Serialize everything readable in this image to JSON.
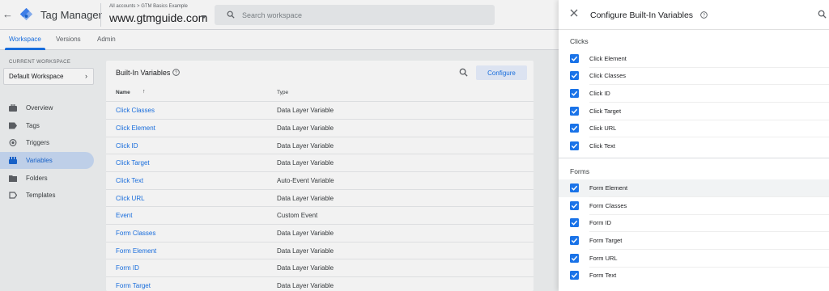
{
  "header": {
    "product_name": "Tag Manager",
    "account_path": "All accounts > GTM Basics Example",
    "container_name": "www.gtmguide.com",
    "search_placeholder": "Search workspace"
  },
  "tabs": [
    {
      "label": "Workspace"
    },
    {
      "label": "Versions"
    },
    {
      "label": "Admin"
    }
  ],
  "sidebar": {
    "current_workspace_label": "CURRENT WORKSPACE",
    "workspace_name": "Default Workspace",
    "items": [
      {
        "label": "Overview",
        "icon": "briefcase-icon"
      },
      {
        "label": "Tags",
        "icon": "tag-icon"
      },
      {
        "label": "Triggers",
        "icon": "trigger-icon"
      },
      {
        "label": "Variables",
        "icon": "variables-icon"
      },
      {
        "label": "Folders",
        "icon": "folder-icon"
      },
      {
        "label": "Templates",
        "icon": "template-icon"
      }
    ]
  },
  "main": {
    "title": "Built-In Variables",
    "configure_label": "Configure",
    "columns": {
      "name": "Name",
      "type": "Type"
    },
    "rows": [
      {
        "name": "Click Classes",
        "type": "Data Layer Variable"
      },
      {
        "name": "Click Element",
        "type": "Data Layer Variable"
      },
      {
        "name": "Click ID",
        "type": "Data Layer Variable"
      },
      {
        "name": "Click Target",
        "type": "Data Layer Variable"
      },
      {
        "name": "Click Text",
        "type": "Auto-Event Variable"
      },
      {
        "name": "Click URL",
        "type": "Data Layer Variable"
      },
      {
        "name": "Event",
        "type": "Custom Event"
      },
      {
        "name": "Form Classes",
        "type": "Data Layer Variable"
      },
      {
        "name": "Form Element",
        "type": "Data Layer Variable"
      },
      {
        "name": "Form ID",
        "type": "Data Layer Variable"
      },
      {
        "name": "Form Target",
        "type": "Data Layer Variable"
      }
    ]
  },
  "panel": {
    "title": "Configure Built-In Variables",
    "sections": [
      {
        "label": "Clicks",
        "items": [
          {
            "label": "Click Element",
            "checked": true
          },
          {
            "label": "Click Classes",
            "checked": true
          },
          {
            "label": "Click ID",
            "checked": true
          },
          {
            "label": "Click Target",
            "checked": true
          },
          {
            "label": "Click URL",
            "checked": true
          },
          {
            "label": "Click Text",
            "checked": true
          }
        ]
      },
      {
        "label": "Forms",
        "items": [
          {
            "label": "Form Element",
            "checked": true
          },
          {
            "label": "Form Classes",
            "checked": true
          },
          {
            "label": "Form ID",
            "checked": true
          },
          {
            "label": "Form Target",
            "checked": true
          },
          {
            "label": "Form URL",
            "checked": true
          },
          {
            "label": "Form Text",
            "checked": true
          }
        ]
      }
    ]
  },
  "colors": {
    "accent": "#1a73e8",
    "active_nav_bg": "#c9dbf5",
    "configure_bg": "#e8f0fe"
  }
}
